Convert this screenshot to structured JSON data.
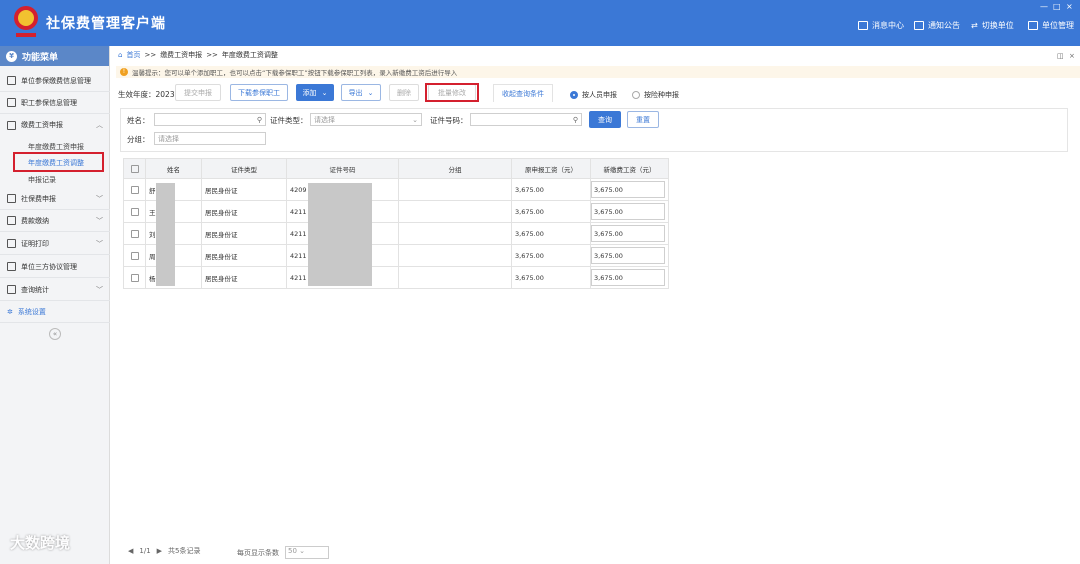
{
  "app": {
    "title": "社保费管理客户端",
    "logo_text": "国家税务总局"
  },
  "topbar": {
    "items": [
      "消息中心",
      "通知公告",
      "切换单位",
      "单位管理"
    ],
    "win_controls": [
      "—",
      "□",
      "×"
    ]
  },
  "sidebar": {
    "header": "功能菜单",
    "items": [
      "单位参保缴费信息管理",
      "职工参保信息管理",
      "缴费工资申报",
      "社保费申报",
      "费款缴纳",
      "证明打印",
      "单位三方协议管理",
      "查询统计",
      "系统设置"
    ],
    "sub_items": [
      "年度缴费工资申报",
      "年度缴费工资调整",
      "申报记录"
    ],
    "collapse_icon": "«"
  },
  "breadcrumb": {
    "home": "首页",
    "sep": ">>",
    "level1": "缴费工资申报",
    "level2": "年度缴费工资调整"
  },
  "tip": "温馨提示：您可以单个添加职工，也可以点击“下载参保职工”按钮下载参保职工列表，录入新缴费工资后进行导入",
  "toolbar": {
    "year_label": "生效年度：2023",
    "submit": "提交申报",
    "download": "下载参保职工",
    "add": "添加",
    "export": "导出",
    "delete": "删除",
    "batch_edit": "批量修改",
    "collapse_query": "收起查询条件",
    "radio_person": "按人员申报",
    "radio_insurance": "按险种申报"
  },
  "filter": {
    "name_label": "姓名：",
    "idtype_label": "证件类型：",
    "idtype_placeholder": "请选择",
    "idno_label": "证件号码：",
    "group_label": "分组：",
    "group_placeholder": "请选择",
    "query": "查询",
    "reset": "重置"
  },
  "table": {
    "headers": [
      "姓名",
      "证件类型",
      "证件号码",
      "分组",
      "原申报工资（元）",
      "新缴费工资（元）"
    ],
    "rows": [
      {
        "name": "舒",
        "idtype": "居民身份证",
        "idno": "4209",
        "group": "",
        "old": "3,675.00",
        "new": "3,675.00"
      },
      {
        "name": "王",
        "idtype": "居民身份证",
        "idno": "4211",
        "group": "",
        "old": "3,675.00",
        "new": "3,675.00"
      },
      {
        "name": "刘",
        "idtype": "居民身份证",
        "idno": "4211",
        "group": "",
        "old": "3,675.00",
        "new": "3,675.00"
      },
      {
        "name": "周",
        "idtype": "居民身份证",
        "idno": "4211",
        "group": "",
        "old": "3,675.00",
        "new": "3,675.00"
      },
      {
        "name": "杨",
        "idtype": "居民身份证",
        "idno": "4211",
        "group": "",
        "old": "3,675.00",
        "new": "3,675.00"
      }
    ]
  },
  "pager": {
    "pages": "1/1",
    "total": "共5条记录",
    "per_page_label": "每页显示条数",
    "per_page": "50"
  },
  "watermark": "大数跨境"
}
